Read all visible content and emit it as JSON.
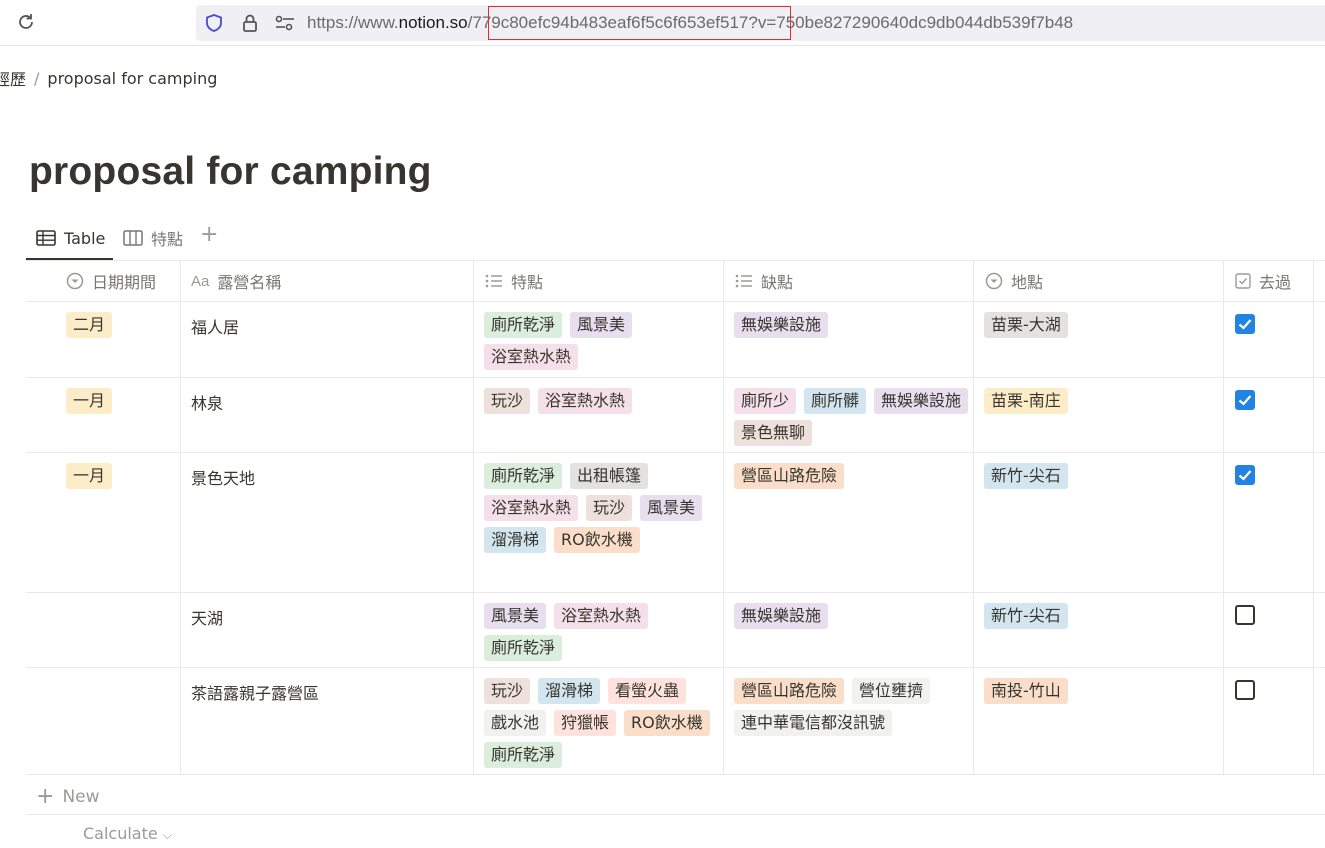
{
  "browser": {
    "url_prefix": "https://www.",
    "url_host": "notion.so",
    "url_path": "/779c80efc94b483eaf6f5c6f653ef517",
    "url_query": "?v=750be827290640dc9db044db539f7b48"
  },
  "breadcrumb": {
    "parent": "經歷",
    "separator": "/",
    "current": "proposal for camping"
  },
  "page": {
    "title": "proposal for camping"
  },
  "views": {
    "tabs": [
      {
        "label": "Table",
        "icon": "table-icon"
      },
      {
        "label": "特點",
        "icon": "board-icon"
      }
    ],
    "add": "+"
  },
  "table": {
    "columns": [
      {
        "label": "日期期間",
        "icon": "select-icon"
      },
      {
        "label": "露營名稱",
        "icon": "title-icon",
        "prefix": "Aa"
      },
      {
        "label": "特點",
        "icon": "list-icon"
      },
      {
        "label": "缺點",
        "icon": "list-icon"
      },
      {
        "label": "地點",
        "icon": "select-icon"
      },
      {
        "label": "去過",
        "icon": "checkbox-icon"
      }
    ],
    "rows": [
      {
        "date": "二月",
        "name": "福人居",
        "pros": [
          {
            "t": "廁所乾淨",
            "c": "green"
          },
          {
            "t": "風景美",
            "c": "purple"
          },
          {
            "t": "浴室熱水熱",
            "c": "pink"
          }
        ],
        "cons": [
          {
            "t": "無娛樂設施",
            "c": "purple"
          }
        ],
        "place": {
          "t": "苗栗-大湖",
          "c": "gray"
        },
        "visited": true
      },
      {
        "date": "一月",
        "name": "林泉",
        "pros": [
          {
            "t": "玩沙",
            "c": "brown"
          },
          {
            "t": "浴室熱水熱",
            "c": "pink"
          }
        ],
        "cons": [
          {
            "t": "廁所少",
            "c": "pink"
          },
          {
            "t": "廁所髒",
            "c": "blue"
          },
          {
            "t": "無娛樂設施",
            "c": "purple"
          },
          {
            "t": "景色無聊",
            "c": "brown"
          }
        ],
        "place": {
          "t": "苗栗-南庄",
          "c": "yellow"
        },
        "visited": true
      },
      {
        "date": "一月",
        "name": "景色天地",
        "pros": [
          {
            "t": "廁所乾淨",
            "c": "green"
          },
          {
            "t": "出租帳篷",
            "c": "gray"
          },
          {
            "t": "浴室熱水熱",
            "c": "pink"
          },
          {
            "t": "玩沙",
            "c": "brown"
          },
          {
            "t": "風景美",
            "c": "purple"
          },
          {
            "t": "溜滑梯",
            "c": "blue"
          },
          {
            "t": "RO飲水機",
            "c": "orange"
          }
        ],
        "cons": [
          {
            "t": "營區山路危險",
            "c": "orange"
          }
        ],
        "place": {
          "t": "新竹-尖石",
          "c": "blue"
        },
        "visited": true
      },
      {
        "date": "",
        "name": "天湖",
        "pros": [
          {
            "t": "風景美",
            "c": "purple"
          },
          {
            "t": "浴室熱水熱",
            "c": "pink"
          },
          {
            "t": "廁所乾淨",
            "c": "green"
          }
        ],
        "cons": [
          {
            "t": "無娛樂設施",
            "c": "purple"
          }
        ],
        "place": {
          "t": "新竹-尖石",
          "c": "blue"
        },
        "visited": false
      },
      {
        "date": "",
        "name": "茶語露親子露營區",
        "pros": [
          {
            "t": "玩沙",
            "c": "brown"
          },
          {
            "t": "溜滑梯",
            "c": "blue"
          },
          {
            "t": "看螢火蟲",
            "c": "red"
          },
          {
            "t": "戲水池",
            "c": "lightgray"
          },
          {
            "t": "狩獵帳",
            "c": "red"
          },
          {
            "t": "RO飲水機",
            "c": "orange"
          },
          {
            "t": "廁所乾淨",
            "c": "green"
          }
        ],
        "cons": [
          {
            "t": "營區山路危險",
            "c": "orange"
          },
          {
            "t": "營位壅擠",
            "c": "lightgray"
          },
          {
            "t": "連中華電信都沒訊號",
            "c": "lightgray"
          }
        ],
        "place": {
          "t": "南投-竹山",
          "c": "orange"
        },
        "visited": false
      }
    ],
    "new_label": "New",
    "calculate_label": "Calculate"
  },
  "tag_colors": {
    "green": "#dbeddb",
    "purple": "#e8deee",
    "pink": "#f5e0e9",
    "brown": "#eee0da",
    "blue": "#d3e5ef",
    "gray": "#e3e2e0",
    "lightgray": "#f1f1ef",
    "orange": "#fadec9",
    "red": "#ffe2dd",
    "yellow": "#fdecc8"
  },
  "accent": {
    "checkbox": "#2383e2",
    "url_highlight": "#d93030"
  }
}
